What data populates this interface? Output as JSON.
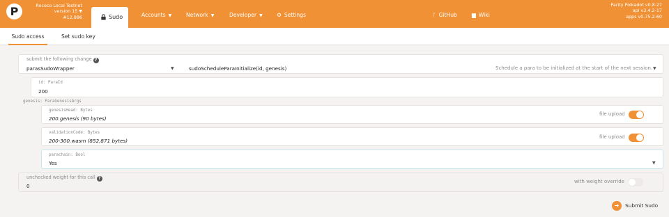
{
  "chain": {
    "name": "Rococo Local Testnet",
    "version": "version 15",
    "block": "#12,886"
  },
  "nav": {
    "sudo": "Sudo",
    "accounts": "Accounts",
    "network": "Network",
    "developer": "Developer",
    "settings": "Settings",
    "github": "GitHub",
    "wiki": "Wiki"
  },
  "version_info": {
    "node": "Parity Polkadot v0.8.27",
    "api": "api v3.4.2-17",
    "apps": "apps v0.75.2-60"
  },
  "subtabs": {
    "sudo_access": "Sudo access",
    "set_sudo_key": "Set sudo key"
  },
  "change": {
    "label": "submit the following change",
    "module": "parasSudoWrapper",
    "method": "sudoScheduleParaInitialize(id, genesis)",
    "method_doc": "Schedule a para to be initialized at the start of the next session."
  },
  "params": {
    "id": {
      "label": "id: ParaId",
      "value": "200"
    },
    "genesis_label": "genesis: ParaGenesisArgs",
    "genesis_head": {
      "label": "genesisHead: Bytes",
      "value": "200.genesis (90 bytes)",
      "upload_label": "file upload"
    },
    "validation_code": {
      "label": "validationCode: Bytes",
      "value": "200-300.wasm (852,871 bytes)",
      "upload_label": "file upload"
    },
    "parachain": {
      "label": "parachain: Bool",
      "value": "Yes"
    }
  },
  "weight": {
    "label": "unchecked weight for this call",
    "value": "0",
    "override_label": "with weight override"
  },
  "actions": {
    "submit": "Submit Sudo"
  },
  "colors": {
    "accent": "#f19135",
    "background": "#f5f3f1"
  }
}
